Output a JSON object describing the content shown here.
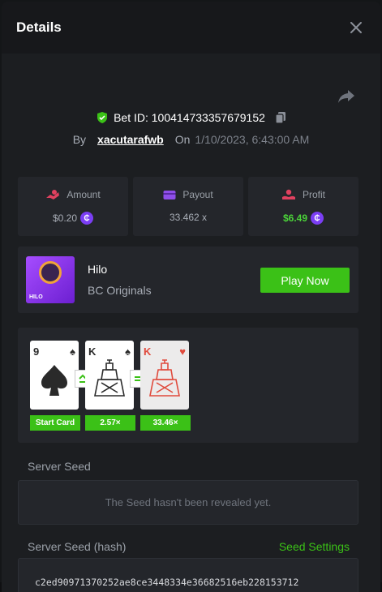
{
  "modal": {
    "title": "Details"
  },
  "bet": {
    "id_label": "Bet ID: 100414733357679152",
    "by_label": "By",
    "username": "xacutarafwb",
    "on_label": "On",
    "date": "1/10/2023, 6:43:00 AM"
  },
  "stats": {
    "amount_label": "Amount",
    "amount_value": "$0.20",
    "payout_label": "Payout",
    "payout_value": "33.462 x",
    "profit_label": "Profit",
    "profit_value": "$6.49"
  },
  "game": {
    "name": "Hilo",
    "provider": "BC Originals",
    "thumb_text": "HILO",
    "play_label": "Play Now"
  },
  "cards": [
    {
      "rank": "9",
      "suit": "♠",
      "badge": "Start Card"
    },
    {
      "rank": "K",
      "suit": "♠",
      "badge": "2.57×"
    },
    {
      "rank": "K",
      "suit": "♥",
      "badge": "33.46×"
    }
  ],
  "seeds": {
    "server_seed_label": "Server Seed",
    "server_seed_placeholder": "The Seed hasn't been revealed yet.",
    "server_seed_hash_label": "Server Seed (hash)",
    "seed_settings_label": "Seed Settings",
    "server_seed_hash": "c2ed90971370252ae8ce3448334e36682516eb228153712"
  },
  "backdrop": {
    "footer_left": "560",
    "footer_mid": "532"
  },
  "colors": {
    "accent_green": "#3bc117",
    "coin_purple": "#7b3ef5",
    "panel": "#24262b",
    "modal_bg": "#1c1e21"
  }
}
